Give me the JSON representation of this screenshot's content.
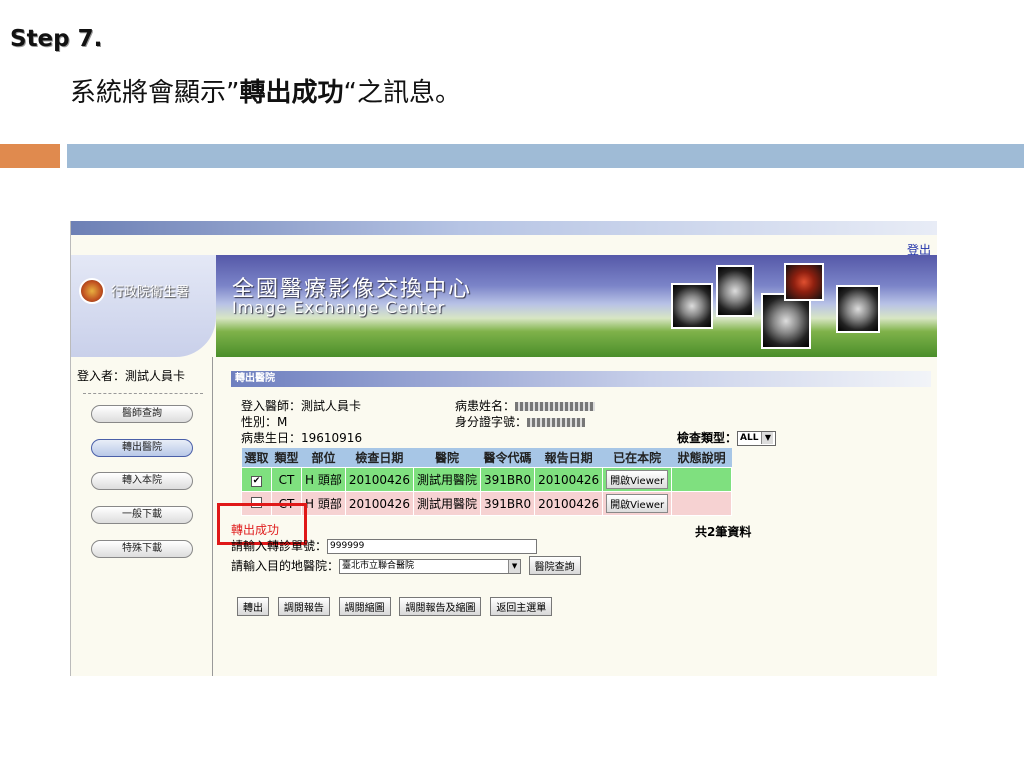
{
  "slide": {
    "step": "Step 7.",
    "subtitle_pre": "系統將會顯示”",
    "subtitle_bold": "轉出成功",
    "subtitle_post": "“之訊息。"
  },
  "app": {
    "logout": "登出",
    "agency": "行政院衛生署",
    "title_zh": "全國醫療影像交換中心",
    "title_en": "Image Exchange Center"
  },
  "sidebar": {
    "login_user": "登入者：測試人員卡",
    "items": [
      "醫師查詢",
      "轉出醫院",
      "轉入本院",
      "一般下載",
      "特殊下載"
    ],
    "active_index": 1
  },
  "main": {
    "section_title": "轉出醫院",
    "doctor_line": "登入醫師：測試人員卡",
    "gender_line": "性別：M",
    "birth_line": "病患生日：19610916",
    "patient_name_label": "病患姓名：",
    "id_label": "身分證字號：",
    "exam_type_label": "檢查類型：",
    "exam_type_value": "ALL",
    "columns": [
      "選取",
      "類型",
      "部位",
      "檢查日期",
      "醫院",
      "醫令代碼",
      "報告日期",
      "已在本院",
      "狀態說明"
    ],
    "rows": [
      {
        "checked": true,
        "type": "CT",
        "part": "H 頭部",
        "date": "20100426",
        "hospital": "測試用醫院",
        "code": "391BR0",
        "report": "20100426",
        "open": "開啟Viewer",
        "status": ""
      },
      {
        "checked": false,
        "type": "CT",
        "part": "H 頭部",
        "date": "20100426",
        "hospital": "測試用醫院",
        "code": "391BR0",
        "report": "20100426",
        "open": "開啟Viewer",
        "status": ""
      }
    ],
    "total": "共2筆資料",
    "success_message": "轉出成功",
    "referral_label": "請輸入轉診單號：",
    "referral_value": "999999",
    "dest_label": "請輸入目的地醫院：",
    "dest_value": "臺北市立聯合醫院",
    "hospital_query_btn": "醫院查詢",
    "actions": [
      "轉出",
      "調閱報告",
      "調閱縮圖",
      "調閱報告及縮圖",
      "返回主選單"
    ]
  },
  "colors": {
    "accent_orange": "#e08a4e",
    "accent_blue": "#9fbbd6",
    "highlight_red": "#e01818",
    "row_selected": "#7fe07f"
  }
}
